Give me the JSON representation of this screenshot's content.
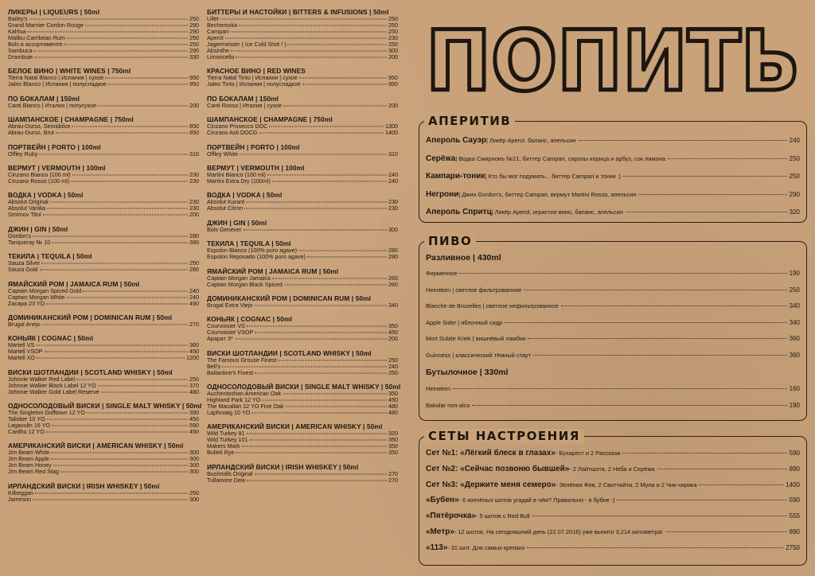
{
  "left_columns": [
    [
      {
        "title": "ЛИКЕРЫ | LIQUEURS | 50ml",
        "items": [
          [
            "Bailey's",
            "250"
          ],
          [
            "Grand Marnier Cordon Rouge",
            "290"
          ],
          [
            "Kahlua",
            "290"
          ],
          [
            "Malibu Carribean Rum",
            "250"
          ],
          [
            "Bols в ассортименте",
            "250"
          ],
          [
            "Sambuca",
            "290"
          ],
          [
            "Drambuie",
            "330"
          ]
        ]
      },
      {
        "title": "БЕЛОЕ ВИНО | WHITE WINES | 750ml",
        "items": [
          [
            "Tierra Natal Blanco | Испания | сухое",
            "950"
          ],
          [
            "Jaleo Blanco | Испания | полусладкое",
            "950"
          ]
        ]
      },
      {
        "title": "ПО БОКАЛАМ | 150ml",
        "items": [
          [
            "Canti Bianco | Италия | полусухое",
            "200"
          ]
        ]
      },
      {
        "title": "ШАМПАНСКОЕ | CHAMPAGNE | 750ml",
        "items": [
          [
            "Abrau-Durso, Semidolce",
            "850"
          ],
          [
            "Abrau-Durso, Brut",
            "850"
          ]
        ]
      },
      {
        "title": "ПОРТВЕЙН | PORTO | 100ml",
        "items": [
          [
            "Offley Ruby",
            "310"
          ]
        ]
      },
      {
        "title": "ВЕРМУТ | VERMOUTH | 100ml",
        "items": [
          [
            "Cinzano Bianco (100 ml)",
            "230"
          ],
          [
            "Cinzano Rosso (100 ml)",
            "230"
          ]
        ]
      },
      {
        "title": "ВОДКА | VODKA | 50ml",
        "items": [
          [
            "Absolut Original",
            "230"
          ],
          [
            "Absolut Vanilia",
            "230"
          ],
          [
            "Smirnov Titul",
            "200"
          ]
        ]
      },
      {
        "title": "ДЖИН | GIN | 50ml",
        "items": [
          [
            "Gordon's",
            "280"
          ],
          [
            "Tanqueray № 10",
            "390"
          ]
        ]
      },
      {
        "title": "ТЕКИЛА | TEQUILA | 50ml",
        "items": [
          [
            "Sauza Silver",
            "250"
          ],
          [
            "Sauza Gold",
            "280"
          ]
        ]
      },
      {
        "title": "ЯМАЙСКИЙ РОМ | JAMAICA RUM | 50ml",
        "items": [
          [
            "Captain Morgan Spiced Gold",
            "240"
          ],
          [
            "Captain Morgan White",
            "240"
          ],
          [
            "Zacapa 23 YO",
            "490"
          ]
        ]
      },
      {
        "title": "ДОМИНИКАНСКИЙ РОМ | DOMINICAN RUM | 50ml",
        "items": [
          [
            "Brugal Anejo",
            "270"
          ]
        ]
      },
      {
        "title": "КОНЬЯК | COGNAC | 50ml",
        "items": [
          [
            "Martell VS",
            "360"
          ],
          [
            "Martell VSOP",
            "450"
          ],
          [
            "Martell XO",
            "1200"
          ]
        ]
      },
      {
        "title": "ВИСКИ ШОТЛАНДИИ | SCOTLAND WHISKY | 50ml",
        "items": [
          [
            "Johnnie Walker Red Label",
            "250"
          ],
          [
            "Johnnie Walker Black Label 12 YO",
            "370"
          ],
          [
            "Johnnie Walker Gold Label Reserve",
            "480"
          ]
        ]
      },
      {
        "title": "ОДНОСОЛОДОВЫЙ ВИСКИ | SINGLE MALT WHISKY | 50ml",
        "items": [
          [
            "The Singleton Dufftown 12 YO",
            "390"
          ],
          [
            "Talisker 10 YO",
            "450"
          ],
          [
            "Lagavulin 16 YO",
            "590"
          ],
          [
            "Cardhu 12 YO",
            "450"
          ]
        ]
      },
      {
        "title": "АМЕРИКАНСКИЙ ВИСКИ | AMERICAN WHISKY | 50ml",
        "items": [
          [
            "Jim Beam White",
            "300"
          ],
          [
            "Jim Beam Apple",
            "300"
          ],
          [
            "Jim Beam Honey",
            "300"
          ],
          [
            "Jim Beam Red Stag",
            "300"
          ]
        ]
      },
      {
        "title": "ИРЛАНДСКИЙ ВИСКИ | IRISH WHISKEY | 50ml",
        "items": [
          [
            "Kilbeggan",
            "250"
          ],
          [
            "Jameson",
            "300"
          ]
        ]
      }
    ],
    [
      {
        "title": "БИТТЕРЫ И НАСТОЙКИ | BITTERS & INFUSIONS | 50ml",
        "items": [
          [
            "Lillet",
            "250"
          ],
          [
            "Becherovka",
            "250"
          ],
          [
            "Campari",
            "250"
          ],
          [
            "Aperol",
            "230"
          ],
          [
            "Jagermeister ( Ice Cold Shot ! )",
            "250"
          ],
          [
            "Absinthe",
            "300"
          ],
          [
            "Limoncello",
            "200"
          ]
        ]
      },
      {
        "title": "КРАСНОЕ ВИНО | RED WINES",
        "items": [
          [
            "Tierra Natal Tinto | Испания | сухое",
            "950"
          ],
          [
            "Jaleo Tinto | Испания | полусладкое",
            "950"
          ]
        ]
      },
      {
        "title": "ПО БОКАЛАМ | 150ml",
        "items": [
          [
            "Canti Rosso | Италия | сухое",
            "200"
          ]
        ]
      },
      {
        "title": "ШАМПАНСКОЕ | CHAMPAGNE | 750ml",
        "items": [
          [
            "Cinzano Prosecco DOC",
            "1300"
          ],
          [
            "Cinzano Asti DOCG",
            "1400"
          ]
        ]
      },
      {
        "title": "ПОРТВЕЙН | PORTO | 100ml",
        "items": [
          [
            "Offley White",
            "310"
          ]
        ]
      },
      {
        "title": "ВЕРМУТ | VERMOUTH | 100ml",
        "items": [
          [
            "Martini Bianco (100 ml)",
            "240"
          ],
          [
            "Martini Extra Dry (100ml)",
            "240"
          ]
        ]
      },
      {
        "title": "ВОДКА | VODKA | 50ml",
        "items": [
          [
            "Absolut Kurant",
            "230"
          ],
          [
            "Absolut Citron",
            "230"
          ]
        ]
      },
      {
        "title": "ДЖИН | GIN | 50ml",
        "items": [
          [
            "Bols Genever",
            "300"
          ]
        ]
      },
      {
        "title": "ТЕКИЛА | TEQUILA | 50ml",
        "items": [
          [
            "Espolon Blanco (100% puro agave)",
            "280"
          ],
          [
            "Espolon Reposado (100% puro agave)",
            "280"
          ]
        ]
      },
      {
        "title": "ЯМАЙСКИЙ РОМ | JAMAICA RUM | 50ml",
        "items": [
          [
            "Captain Morgan Jamaica",
            "260"
          ],
          [
            "Captain Morgan Black Spiced",
            "260"
          ]
        ]
      },
      {
        "title": "ДОМИНИКАНСКИЙ РОМ | DOMINICAN RUM | 50ml",
        "items": [
          [
            "Brugal Extra Viejo",
            "340"
          ]
        ]
      },
      {
        "title": "КОНЬЯК | COGNAC | 50ml",
        "items": [
          [
            "Courvoisier VS",
            "350"
          ],
          [
            "Courvoisier VSOP",
            "450"
          ],
          [
            "Арарат 3*",
            "200"
          ]
        ]
      },
      {
        "title": "ВИСКИ ШОТЛАНДИИ | SCOTLAND WHISKY | 50ml",
        "items": [
          [
            "The Famous Grouse Finest",
            "250"
          ],
          [
            "Bell's",
            "240"
          ],
          [
            "Ballantine's Finest",
            "250"
          ]
        ]
      },
      {
        "title": "ОДНОСОЛОДОВЫЙ ВИСКИ | SINGLE MALT WHISKY | 50ml",
        "items": [
          [
            "Auchentoshan American Oak",
            "350"
          ],
          [
            "Highland Park 12 YO",
            "450"
          ],
          [
            "The Macallan 12 YO Fine Oak",
            "480"
          ],
          [
            "Laphroaig 10 YO",
            "480"
          ]
        ]
      },
      {
        "title": "АМЕРИКАНСКИЙ ВИСКИ | AMERICAN WHISKY | 50ml",
        "items": [
          [
            "Wild Turkey 81",
            "320"
          ],
          [
            "Wild Turkey 101",
            "350"
          ],
          [
            "Makers Mark",
            "350"
          ],
          [
            "Bulleit Rye",
            "350"
          ]
        ]
      },
      {
        "title": "ИРЛАНДСКИЙ ВИСКИ | IRISH WHISKEY | 50ml",
        "items": [
          [
            "Bushmills Original",
            "270"
          ],
          [
            "Tullamore Dew",
            "270"
          ]
        ]
      }
    ]
  ],
  "main_title": "ПОПИТЬ",
  "aperitif": {
    "label": "АПЕРИТИВ",
    "items": [
      {
        "name": "Апероль Сауэр",
        "desc": " | Ликёр Aperol, баланс, апельсин",
        "price": "240"
      },
      {
        "name": "Серёжа",
        "desc": " | Водка Смирновъ №21, биттер Campari, сиропы корица и арбуз, сок лимона",
        "price": "250"
      },
      {
        "name": "Кампари-тоник",
        "desc": " | Кто бы мог подумать... биттер Campari и тоник :)",
        "price": "250"
      },
      {
        "name": "Негрони",
        "desc": " | Джин Gordon's, биттер Campari, вермут Martini Rosso, апельсин",
        "price": "290"
      },
      {
        "name": "Апероль Спритц",
        "desc": " | Ликёр Aperol, игристое вино, баланс, апельсин",
        "price": "320"
      }
    ]
  },
  "beer": {
    "label": "ПИВО",
    "draft_title": "Разливное | 430ml",
    "draft": [
      [
        "Фирменное",
        "190"
      ],
      [
        "Heineken | светлое фильтрованное",
        "250"
      ],
      [
        "Blanche de Bruxelles | светлое нефильтрованное",
        "340"
      ],
      [
        "Apple Sider | яблочный сидр",
        "340"
      ],
      [
        "Mort Subite Kriek | вишнёвый ламбик",
        "360"
      ],
      [
        "Guinness | классический тёмный стаут",
        "360"
      ]
    ],
    "bottled_title": "Бутылочное | 330ml",
    "bottled": [
      [
        "Heineken",
        "160"
      ],
      [
        "Bakalar non-alco",
        "190"
      ]
    ]
  },
  "sets": {
    "label": "СЕТЫ НАСТРОЕНИЯ",
    "items": [
      {
        "name": "Сет №1: «Лёгкий блеск в глазах»",
        "desc": " - Бухарест и 2 Рассказа",
        "price": "590"
      },
      {
        "name": "Сет №2: «Сейчас позвоню бывшей»",
        "desc": " - 2 Лайтшота, 2 Неба и Серёжа",
        "price": "890"
      },
      {
        "name": "Сет №3: «Держите меня семеро»",
        "desc": " - Зелёная Фея, 2 Свитчайта, 2 Мула и 2 Чик-чирика",
        "price": "1400"
      },
      {
        "name": "«Бубен»",
        "desc": " - 6 копчёных шотов угадай в чём? Правильно - в бубне :)",
        "price": "590"
      },
      {
        "name": "«Пятёрочка»",
        "desc": " - 5 шотов с Red Bull",
        "price": "555"
      },
      {
        "name": "«Метр»",
        "desc": " - 12 шотов. На сегодняшний день (22.07.2016) уже выпито 3,214 километра!",
        "price": "890"
      },
      {
        "name": "«113»",
        "desc": " - 31 шот. Для самых крепких",
        "price": "2750"
      }
    ]
  }
}
